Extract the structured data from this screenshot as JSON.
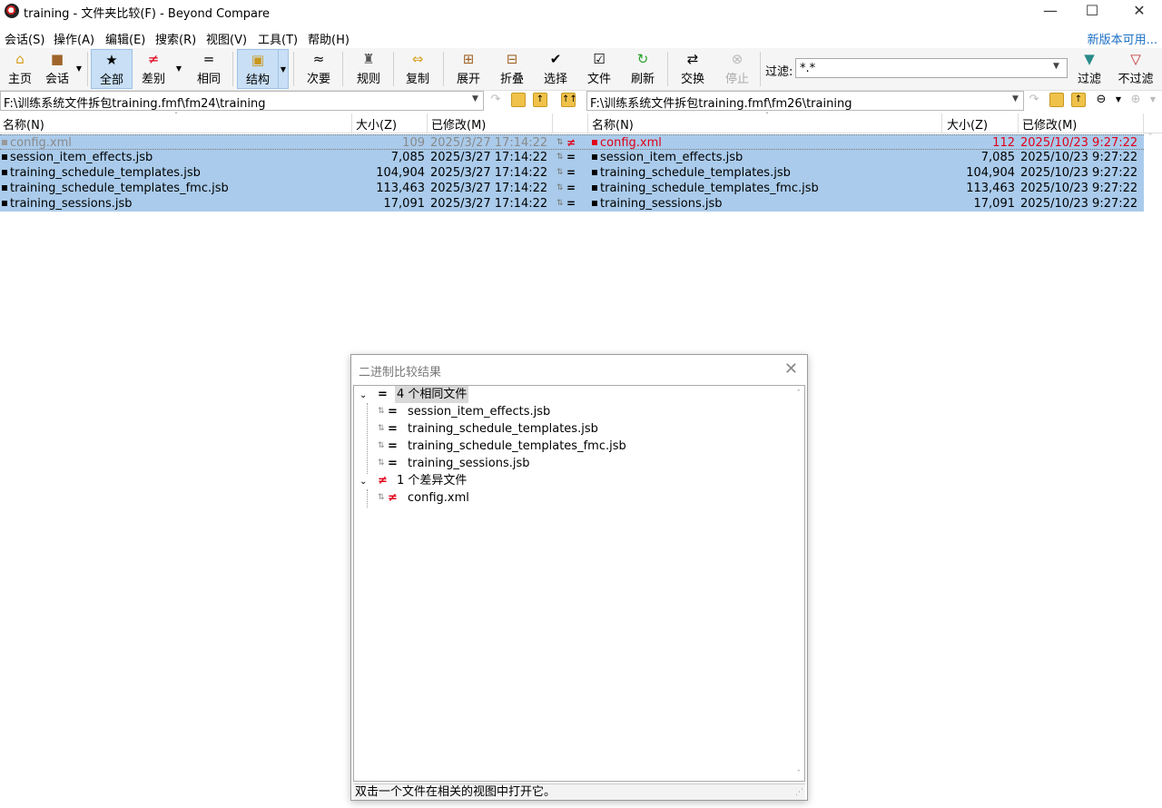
{
  "window": {
    "title": "training - 文件夹比较(F) - Beyond Compare",
    "minimize": "—",
    "maximize": "☐",
    "close": "✕"
  },
  "menu": [
    "会话(S)",
    "操作(A)",
    "编辑(E)",
    "搜索(R)",
    "视图(V)",
    "工具(T)",
    "帮助(H)"
  ],
  "new_version": "新版本可用...",
  "toolbar": {
    "home": "主页",
    "session": "会话",
    "all": "全部",
    "diffs": "差别",
    "same": "相同",
    "structure": "结构",
    "minor": "次要",
    "rules": "规则",
    "copy": "复制",
    "expand": "展开",
    "collapse": "折叠",
    "select": "选择",
    "files": "文件",
    "refresh": "刷新",
    "swap": "交换",
    "stop": "停止",
    "filter": "过滤",
    "no_filter": "不过滤"
  },
  "filter": {
    "label": "过滤:",
    "value": "*.*"
  },
  "paths": {
    "left": "F:\\训练系统文件拆包training.fmf\\fm24\\training",
    "right": "F:\\训练系统文件拆包training.fmf\\fm26\\training"
  },
  "columns": {
    "name": "名称(N)",
    "size": "大小(Z)",
    "modified": "已修改(M)"
  },
  "left_files": [
    {
      "name": "config.xml",
      "size": "109",
      "date": "2025/3/27 17:14:22"
    },
    {
      "name": "session_item_effects.jsb",
      "size": "7,085",
      "date": "2025/3/27 17:14:22"
    },
    {
      "name": "training_schedule_templates.jsb",
      "size": "104,904",
      "date": "2025/3/27 17:14:22"
    },
    {
      "name": "training_schedule_templates_fmc.jsb",
      "size": "113,463",
      "date": "2025/3/27 17:14:22"
    },
    {
      "name": "training_sessions.jsb",
      "size": "17,091",
      "date": "2025/3/27 17:14:22"
    }
  ],
  "right_files": [
    {
      "name": "config.xml",
      "size": "112",
      "date": "2025/10/23 9:27:22"
    },
    {
      "name": "session_item_effects.jsb",
      "size": "7,085",
      "date": "2025/10/23 9:27:22"
    },
    {
      "name": "training_schedule_templates.jsb",
      "size": "104,904",
      "date": "2025/10/23 9:27:22"
    },
    {
      "name": "training_schedule_templates_fmc.jsb",
      "size": "113,463",
      "date": "2025/10/23 9:27:22"
    },
    {
      "name": "training_sessions.jsb",
      "size": "17,091",
      "date": "2025/10/23 9:27:22"
    }
  ],
  "colors": {
    "selection": "#aacbeb",
    "diff_red": "#e0001a",
    "link_blue": "#1a6fc4"
  },
  "dialog": {
    "title": "二进制比较结果",
    "same_group": "4 个相同文件",
    "same_files": [
      "session_item_effects.jsb",
      "training_schedule_templates.jsb",
      "training_schedule_templates_fmc.jsb",
      "training_sessions.jsb"
    ],
    "diff_group": "1 个差异文件",
    "diff_files": [
      "config.xml"
    ],
    "status": "双击一个文件在相关的视图中打开它。"
  }
}
